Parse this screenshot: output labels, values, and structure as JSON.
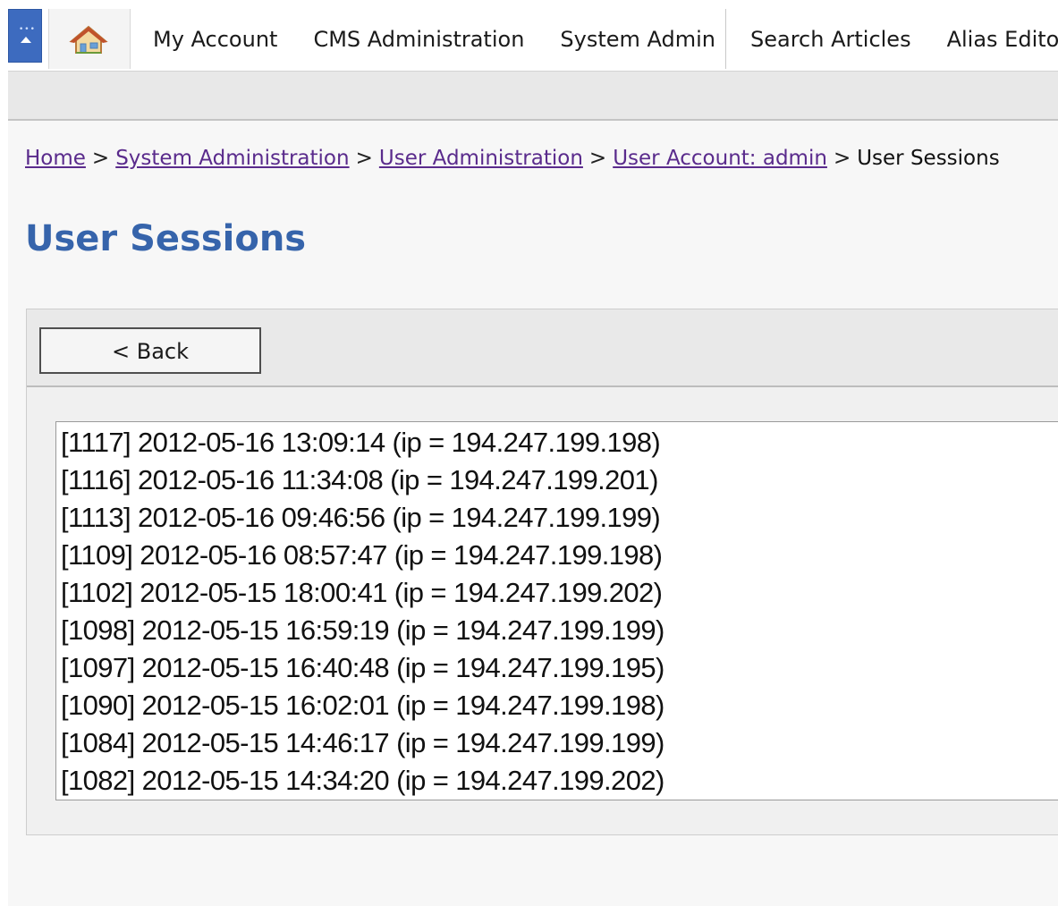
{
  "nav": {
    "items": [
      "My Account",
      "CMS Administration",
      "System Admin"
    ],
    "items_right": [
      "Search Articles",
      "Alias Editor"
    ]
  },
  "breadcrumb": {
    "links": [
      "Home",
      "System Administration",
      "User Administration",
      "User Account: admin"
    ],
    "separator": ">",
    "current": "User Sessions"
  },
  "page": {
    "title": "User Sessions"
  },
  "toolbar": {
    "back_label": "< Back"
  },
  "sessions": [
    "[1117] 2012-05-16 13:09:14 (ip = 194.247.199.198)",
    "[1116] 2012-05-16 11:34:08 (ip = 194.247.199.201)",
    "[1113] 2012-05-16 09:46:56 (ip = 194.247.199.199)",
    "[1109] 2012-05-16 08:57:47 (ip = 194.247.199.198)",
    "[1102] 2012-05-15 18:00:41 (ip = 194.247.199.202)",
    "[1098] 2012-05-15 16:59:19 (ip = 194.247.199.199)",
    "[1097] 2012-05-15 16:40:48 (ip = 194.247.199.195)",
    "[1090] 2012-05-15 16:02:01 (ip = 194.247.199.198)",
    "[1084] 2012-05-15 14:46:17 (ip = 194.247.199.199)",
    "[1082] 2012-05-15 14:34:20 (ip = 194.247.199.202)"
  ],
  "colors": {
    "accent": "#3d6bbf",
    "title": "#3664ab",
    "link": "#5a2b8c"
  },
  "icons": {
    "collapse": "collapse-menu-icon",
    "home": "home-icon"
  }
}
